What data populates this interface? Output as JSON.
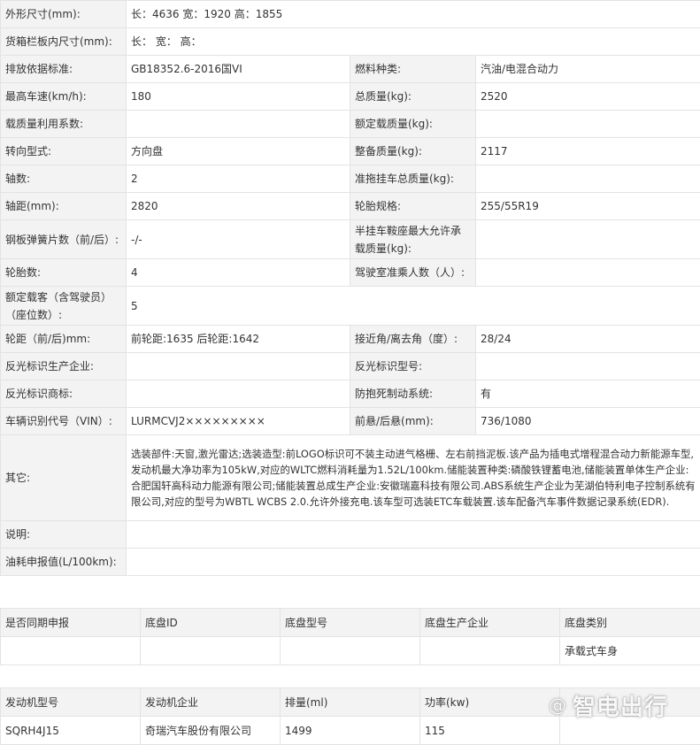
{
  "spec": {
    "outer_dims_label": "外形尺寸(mm):",
    "outer_dims_value": "长：4636 宽：1920 高：1855",
    "cargo_dims_label": "货箱栏板内尺寸(mm):",
    "cargo_dims_value": "长：  宽：  高：",
    "emission_label": "排放依据标准:",
    "emission_value": "GB18352.6-2016国VI",
    "fuel_label": "燃料种类:",
    "fuel_value": "汽油/电混合动力",
    "max_speed_label": "最高车速(km/h):",
    "max_speed_value": "180",
    "total_mass_label": "总质量(kg):",
    "total_mass_value": "2520",
    "load_util_label": "载质量利用系数:",
    "load_util_value": "",
    "rated_load_label": "额定载质量(kg):",
    "rated_load_value": "",
    "steering_label": "转向型式:",
    "steering_value": "方向盘",
    "curb_mass_label": "整备质量(kg):",
    "curb_mass_value": "2117",
    "axles_label": "轴数:",
    "axles_value": "2",
    "trailer_mass_label": "准拖挂车总质量(kg):",
    "trailer_mass_value": "",
    "wheelbase_label": "轴距(mm):",
    "wheelbase_value": "2820",
    "tire_spec_label": "轮胎规格:",
    "tire_spec_value": "255/55R19",
    "spring_label": "钢板弹簧片数（前/后）:",
    "spring_value": "-/-",
    "semi_trailer_label": "半挂车鞍座最大允许承载质量(kg):",
    "semi_trailer_value": "",
    "tire_count_label": "轮胎数:",
    "tire_count_value": "4",
    "cab_seats_label": "驾驶室准乘人数（人）:",
    "cab_seats_value": "",
    "rated_pass_label": "额定载客（含驾驶员）（座位数）:",
    "rated_pass_value": "5",
    "track_label": "轮距（前/后)mm:",
    "track_value": "前轮距:1635 后轮距:1642",
    "angle_label": "接近角/离去角（度）:",
    "angle_value": "28/24",
    "reflect_maker_label": "反光标识生产企业:",
    "reflect_maker_value": "",
    "reflect_model_label": "反光标识型号:",
    "reflect_model_value": "",
    "reflect_brand_label": "反光标识商标:",
    "reflect_brand_value": "",
    "abs_label": "防抱死制动系统:",
    "abs_value": "有",
    "vin_label": "车辆识别代号（VIN）:",
    "vin_value": "LURMCVJ2×××××××××",
    "overhang_label": "前悬/后悬(mm):",
    "overhang_value": "736/1080",
    "other_label": "其它:",
    "other_value": "选装部件:天窗,激光雷达;选装造型:前LOGO标识可不装主动进气格栅、左右前挡泥板.该产品为插电式增程混合动力新能源车型,发动机最大净功率为105kW,对应的WLTC燃料消耗量为1.52L/100km.储能装置种类:磷酸铁锂蓄电池,储能装置单体生产企业:合肥国轩高科动力能源有限公司;储能装置总成生产企业:安徽瑞嘉科技有限公司.ABS系统生产企业为芜湖伯特利电子控制系统有限公司,对应的型号为WBTL WCBS 2.0.允许外接充电.该车型可选装ETC车载装置.该车配备汽车事件数据记录系统(EDR).",
    "note_label": "说明:",
    "note_value": "",
    "fuel_consumption_label": "油耗申报值(L/100km):",
    "fuel_consumption_value": ""
  },
  "chassis": {
    "headers": [
      "是否同期申报",
      "底盘ID",
      "底盘型号",
      "底盘生产企业",
      "底盘类别"
    ],
    "row": [
      "",
      "",
      "",
      "",
      "承载式车身"
    ]
  },
  "engine": {
    "headers": [
      "发动机型号",
      "发动机企业",
      "排量(ml)",
      "功率(kw)",
      ""
    ],
    "row": [
      "SQRH4J15",
      "奇瑞汽车股份有限公司",
      "1499",
      "115",
      ""
    ]
  },
  "watermark": {
    "text": "智电出行",
    "at": "@"
  }
}
